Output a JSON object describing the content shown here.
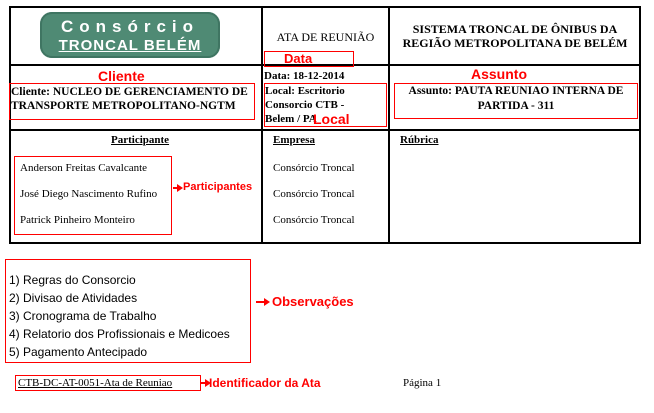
{
  "header": {
    "logo": {
      "line1": "Consórcio",
      "line2": "TRONCAL BELÉM"
    },
    "doc_type": "ATA DE REUNIÃO",
    "system_name": "SISTEMA TRONCAL DE ÔNIBUS DA REGIÃO METROPOLITANA DE BELÉM"
  },
  "info": {
    "data": "Data: 18-12-2014",
    "cliente": "Cliente: NUCLEO DE GERENCIAMENTO DE TRANSPORTE METROPOLITANO-NGTM",
    "local": "Local: Escritorio Consorcio CTB - Belem / PA",
    "assunto": "Assunto: PAUTA REUNIAO INTERNA DE PARTIDA - 311"
  },
  "annotations": {
    "data": "Data",
    "cliente": "Cliente",
    "assunto": "Assunto",
    "local": "Local",
    "participantes": "Participantes",
    "observacoes": "Observações",
    "identificador": "Identificador da Ata"
  },
  "participants_table": {
    "headers": {
      "participante": "Participante",
      "empresa": "Empresa",
      "rubrica": "Rúbrica"
    },
    "rows": [
      {
        "name": "Anderson Freitas Cavalcante",
        "company": "Consórcio Troncal"
      },
      {
        "name": "José Diego Nascimento Rufino",
        "company": "Consórcio Troncal"
      },
      {
        "name": "Patrick Pinheiro Monteiro",
        "company": "Consórcio Troncal"
      }
    ]
  },
  "observacoes": [
    "1) Regras do Consorcio",
    "2) Divisao de Atividades",
    "3) Cronograma de Trabalho",
    "4) Relatorio dos Profissionais e Medicoes",
    "5) Pagamento Antecipado"
  ],
  "footer": {
    "identifier": "CTB-DC-AT-0051-Ata de Reuniao",
    "page": "Página 1"
  },
  "colors": {
    "annotation_red": "#ff0000",
    "logo_green": "#4f8a74"
  }
}
